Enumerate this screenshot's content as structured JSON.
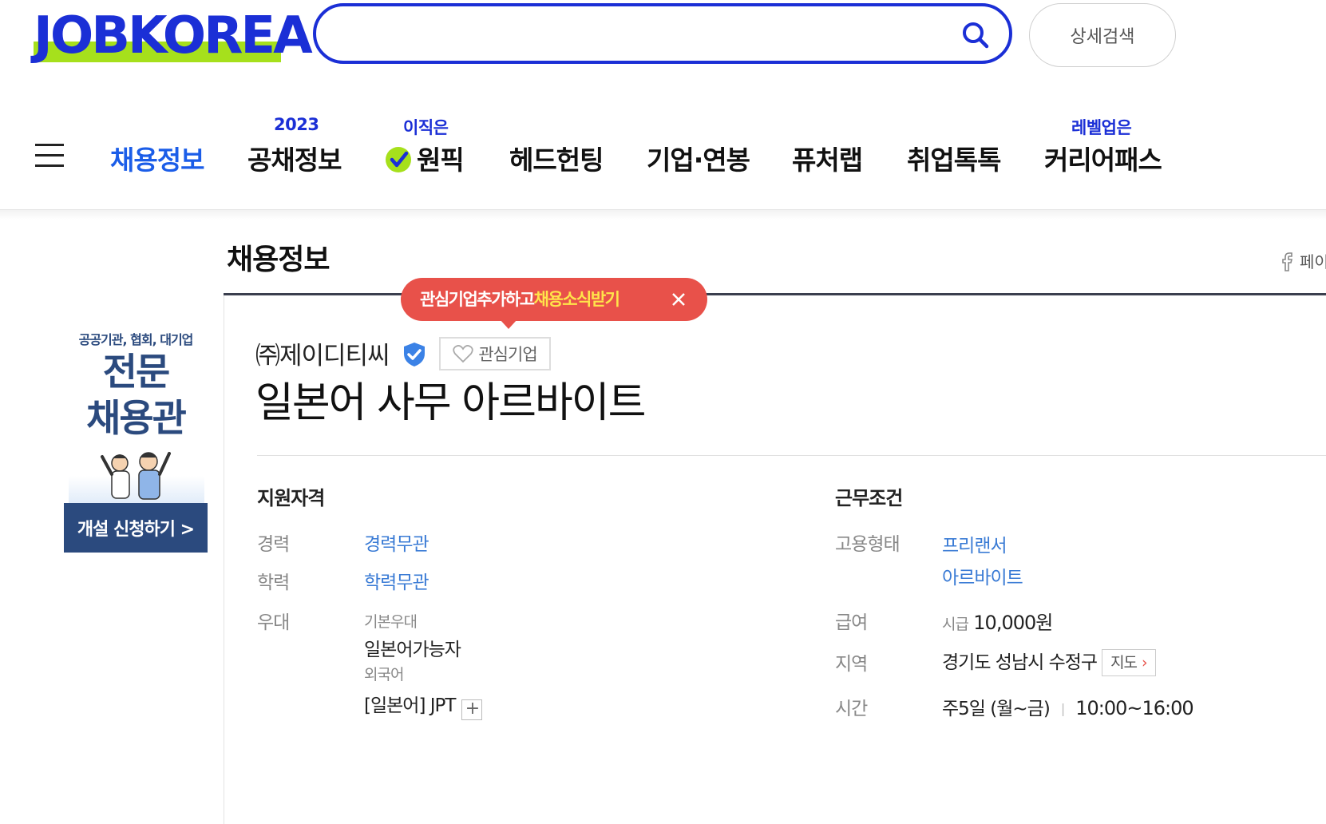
{
  "header": {
    "logo_text": "JOBKOREA",
    "search_placeholder": "",
    "detail_search_label": "상세검색"
  },
  "nav": {
    "items": [
      {
        "label": "채용정보",
        "sup": ""
      },
      {
        "label": "공채정보",
        "sup": "2023"
      },
      {
        "label": "원픽",
        "sup": "이직은"
      },
      {
        "label": "헤드헌팅",
        "sup": ""
      },
      {
        "label": "기업·연봉",
        "sup": ""
      },
      {
        "label": "퓨처랩",
        "sup": ""
      },
      {
        "label": "취업톡톡",
        "sup": ""
      },
      {
        "label": "커리어패스",
        "sup": "레벨업은"
      }
    ]
  },
  "banner": {
    "small_text": "공공기관, 협회, 대기업",
    "big_line1": "전문",
    "big_line2": "채용관",
    "cta": "개설 신청하기 >"
  },
  "page": {
    "section_title": "채용정보",
    "facebook_label": "페이"
  },
  "tooltip": {
    "text_before": "관심기업추가하고",
    "text_highlight": "채용소식받기"
  },
  "job": {
    "company": "㈜제이디티씨",
    "fav_label": "관심기업",
    "title": "일본어 사무 아르바이트"
  },
  "qualifications": {
    "heading": "지원자격",
    "experience_label": "경력",
    "experience_value": "경력무관",
    "education_label": "학력",
    "education_value": "학력무관",
    "preference_label": "우대",
    "preference_basic_label": "기본우대",
    "preference_basic_value": "일본어가능자",
    "preference_lang_label": "외국어",
    "preference_lang_value": "[일본어] JPT",
    "plus_label": "+"
  },
  "conditions": {
    "heading": "근무조건",
    "employment_label": "고용형태",
    "employment_values": [
      "프리랜서",
      "아르바이트"
    ],
    "salary_label": "급여",
    "salary_prefix": "시급",
    "salary_value": "10,000원",
    "region_label": "지역",
    "region_value": "경기도 성남시 수정구",
    "map_label": "지도",
    "time_label": "시간",
    "time_days": "주5일 (월~금)",
    "time_hours": "10:00~16:00"
  },
  "colors": {
    "brand_blue": "#1b2fd6",
    "active_nav": "#1b5de8",
    "logo_highlight": "#a6e01c",
    "tooltip_bg": "#e8514a",
    "link_blue": "#3a7bd5",
    "banner_navy": "#2b4a7e"
  }
}
